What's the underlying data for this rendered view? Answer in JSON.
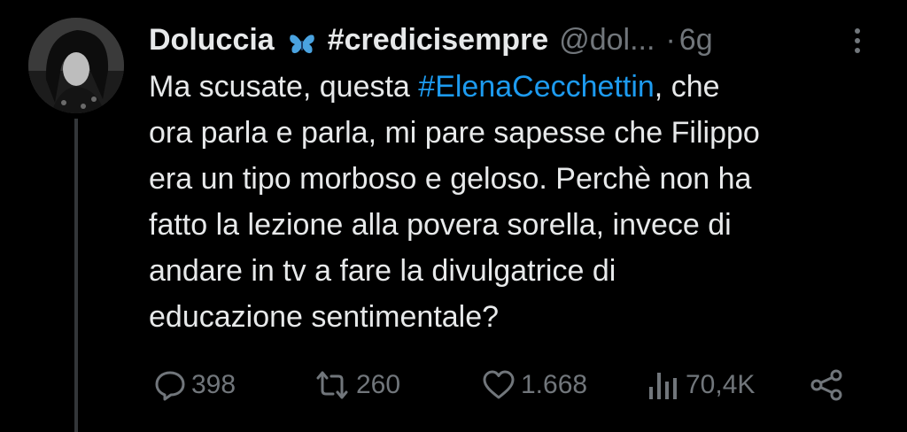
{
  "tweet": {
    "display_name": "Doluccia",
    "name_emoji": "butterfly-icon",
    "name_hashtag": "#credicisempre",
    "handle": "@dol...",
    "dot": "·",
    "time": "6g",
    "text_lines": [
      {
        "before": "Ma scusate, questa ",
        "hashtag": "#ElenaCecchettin",
        "after": ", che"
      },
      {
        "text": "ora parla e parla, mi pare sapesse che Filippo"
      },
      {
        "text": "era un tipo morboso e geloso. Perchè non ha"
      },
      {
        "text": "fatto la lezione alla povera sorella, invece di"
      },
      {
        "text": "andare in tv a fare la divulgatrice di"
      },
      {
        "text": "educazione sentimentale?"
      }
    ],
    "actions": {
      "replies": "398",
      "reposts": "260",
      "likes": "1.668",
      "views": "70,4K"
    }
  },
  "colors": {
    "background": "#000000",
    "text": "#e7e9ea",
    "secondary": "#71767b",
    "link": "#1d9bf0",
    "butterfly": "#4aa3e0"
  },
  "icons": [
    "more-icon",
    "reply-icon",
    "repost-icon",
    "like-icon",
    "views-icon",
    "share-icon"
  ]
}
